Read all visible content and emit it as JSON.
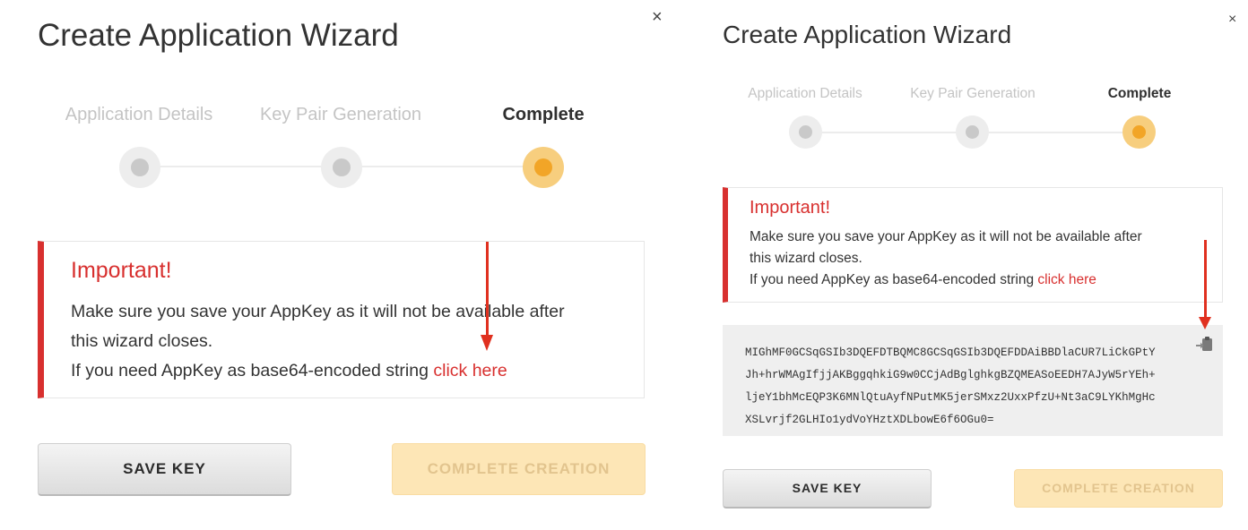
{
  "left": {
    "title": "Create Application Wizard",
    "close_glyph": "×",
    "steps": [
      {
        "label": "Application Details",
        "active": false
      },
      {
        "label": "Key Pair Generation",
        "active": false
      },
      {
        "label": "Complete",
        "active": true
      }
    ],
    "notice": {
      "title": "Important!",
      "line1": "Make sure you save your AppKey as it will not be available after",
      "line2": "this wizard closes.",
      "line3_prefix": "If you need AppKey as base64-encoded string ",
      "link": "click here"
    },
    "buttons": {
      "save": "SAVE KEY",
      "complete": "COMPLETE CREATION"
    }
  },
  "right": {
    "title": "Create Application Wizard",
    "close_glyph": "×",
    "steps": [
      {
        "label": "Application Details",
        "active": false
      },
      {
        "label": "Key Pair Generation",
        "active": false
      },
      {
        "label": "Complete",
        "active": true
      }
    ],
    "notice": {
      "title": "Important!",
      "line1": "Make sure you save your AppKey as it will not be available after",
      "line2": "this wizard closes.",
      "line3_prefix": "If you need AppKey as base64-encoded string ",
      "link": "click here"
    },
    "key_lines": [
      "MIGhMF0GCSqGSIb3DQEFDTBQMC8GCSqGSIb3DQEFDDAiBBDlaCUR7LiCkGPtY",
      "Jh+hrWMAgIfjjAKBggqhkiG9w0CCjAdBglghkgBZQMEASoEEDH7AJyW5rYEh+",
      "ljeY1bhMcEQP3K6MNlQtuAyfNPutMK5jerSMxz2UxxPfzU+Nt3aC9LYKhMgHc",
      "XSLvrjf2GLHIo1ydVoYHztXDLbowE6f6OGu0="
    ],
    "buttons": {
      "save": "SAVE KEY",
      "complete": "COMPLETE CREATION"
    }
  },
  "colors": {
    "accent": "#d8302f",
    "active_step": "#f2a527",
    "arrow": "#e0301f"
  },
  "icons": {
    "close": "close-icon",
    "copy": "clipboard-icon",
    "arrow": "red-arrow-annotation"
  }
}
